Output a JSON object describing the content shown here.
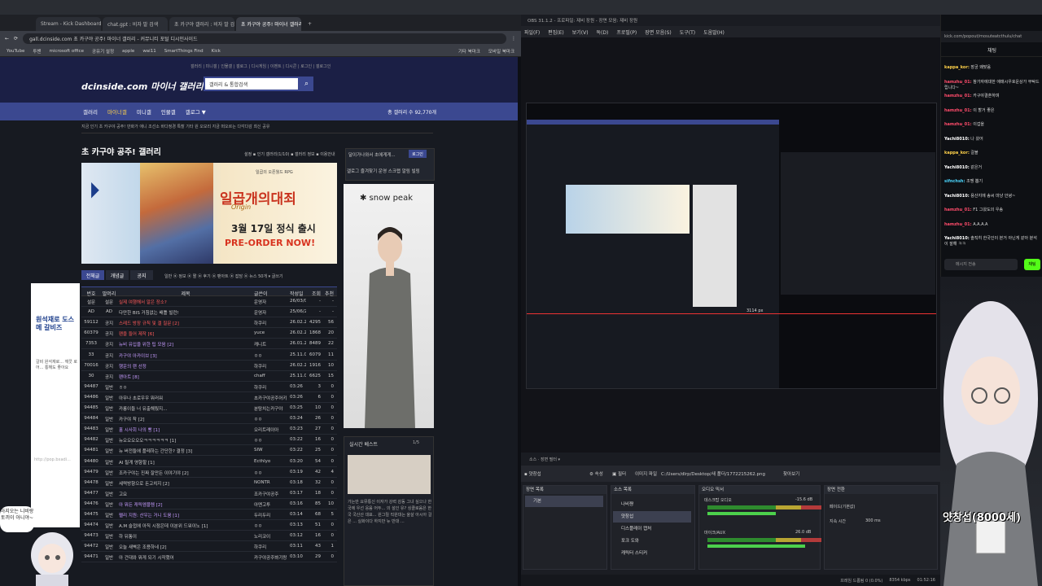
{
  "browser": {
    "tabs": [
      "Stream - Kick Dashboard",
      "chat.gpt : 비자 발 검색",
      "초 카구야 갤러리 : 비자 발 검색",
      "초 카구야 공주! 마이너 갤러리"
    ],
    "url": "gall.dcinside.com  초 카구야 공주! 마이너 갤러리 - 커뮤니티 포털 디시인사이드",
    "bookmarks": [
      "YouTube",
      "투챈",
      "microsoft office",
      "공유기 설정",
      "apple",
      "wai11",
      "SmartThings Find",
      "Kick",
      "기타 북마크",
      "모바일 북마크"
    ]
  },
  "dc": {
    "logo": "dcinside.com 마이너 갤러리",
    "search_placeholder": "갤러리 & 통합검색",
    "top_menu": "갤러리 | 미니갤 | 인물갤 | 갤로그 | 디시게임 | 이벤트 | 디시콘 | 로그인 | 갤로그인",
    "nav": [
      "갤러리",
      "마이너갤",
      "미니갤",
      "인물갤",
      "갤로그 ▼"
    ],
    "nav_count": "총 갤러리 수 92,770개",
    "cat_bar": "지금 인기  초 카구야 공주!   만화가   애니   조선소   바다정경   특촬   기타   원   오모리   지금 떠오르는   다각다감   최신   공유",
    "gallery_title": "초 카구야 공주! 갤러리",
    "gallery_tools": "설정 ▪ 인기 갤러리(1/10) ▪ 갤러리 정보 ▪ 이용안내",
    "right_panel": "달이가나와서 초에게게...",
    "login_btn": "로그인",
    "right_menu": "갤로그   즐겨찾기   운영   스크랩   알림   빌링",
    "ad1": {
      "top": "일곱의 오픈월드 RPG",
      "title": "일곱개의대죄",
      "sub": "Origin",
      "release": "3월 17일 정식 출시",
      "preorder": "PRE-ORDER NOW!"
    },
    "ad2_brand": "✱ snow peak",
    "tabs": [
      "전체글",
      "개념글",
      "공지"
    ],
    "filters": "일반  ⦿ 정보  ⦿ 짤  ⦿ 후기  ⦿ 팬아트  ⦿ 잡담  ⦿ 뉴스  50개 ▾  글쓰기",
    "headers": [
      "번호",
      "말머리",
      "제목",
      "글쓴이",
      "작성일",
      "조회",
      "추천"
    ],
    "rows": [
      {
        "no": "설문",
        "head": "설문",
        "title": "실제 여행해서 알은 장소?",
        "writer": "운영자",
        "date": "26/03/01",
        "views": "-",
        "rec": "-",
        "cls": "red"
      },
      {
        "no": "AD",
        "head": "AD",
        "title": "다만한 BIS 거침없는 배틀 빌런!",
        "writer": "운영자",
        "date": "25/06/24",
        "views": "-",
        "rec": "-",
        "cls": ""
      },
      {
        "no": "59112",
        "head": "공지",
        "title": "스레드 방장 규칙 및 갤 질문 [2]",
        "writer": "하쿠리",
        "date": "26.02.22",
        "views": "4295",
        "rec": "56",
        "cls": "red"
      },
      {
        "no": "60379",
        "head": "공지",
        "title": "팬을 들어 제작 [6]",
        "writer": "yuce",
        "date": "26.02.23",
        "views": "1868",
        "rec": "20",
        "cls": "red"
      },
      {
        "no": "7353",
        "head": "공지",
        "title": "뉴비 유입을 위한 팁 모음 [2]",
        "writer": "캐니트",
        "date": "26.01.27",
        "views": "8489",
        "rec": "22",
        "cls": "purple"
      },
      {
        "no": "33",
        "head": "공지",
        "title": "카구야 아카이브 [3]",
        "writer": "ㅇㅇ",
        "date": "25.11.08",
        "views": "6079",
        "rec": "11",
        "cls": "purple"
      },
      {
        "no": "70016",
        "head": "공지",
        "title": "행운의 랜 선정",
        "writer": "하쿠리",
        "date": "26.02.26",
        "views": "1916",
        "rec": "10",
        "cls": "purple"
      },
      {
        "no": "30",
        "head": "공지",
        "title": "팬아트 [8]",
        "writer": "chaff",
        "date": "25.11.08",
        "views": "6625",
        "rec": "15",
        "cls": "purple"
      },
      {
        "no": "94487",
        "head": "일반",
        "title": "ㅎㅇ",
        "writer": "하쿠리",
        "date": "03:26",
        "views": "3",
        "rec": "0",
        "cls": ""
      },
      {
        "no": "94486",
        "head": "일반",
        "title": "아무나 초로우우 뭐러워",
        "writer": "초카구야공주어키가...",
        "date": "03:26",
        "views": "6",
        "rec": "0",
        "cls": ""
      },
      {
        "no": "94485",
        "head": "일반",
        "title": "카롱이들 너 유출해뒀지...",
        "writer": "분탕치는카구야",
        "date": "03:25",
        "views": "10",
        "rec": "0",
        "cls": ""
      },
      {
        "no": "94484",
        "head": "일반",
        "title": "카구야 착 [2]",
        "writer": "ㅇㅇ",
        "date": "03:24",
        "views": "26",
        "rec": "0",
        "cls": ""
      },
      {
        "no": "94483",
        "head": "일반",
        "title": "홀 시사회 나의 빵 [1]",
        "writer": "오리트레이아",
        "date": "03:23",
        "views": "27",
        "rec": "0",
        "cls": "purple"
      },
      {
        "no": "94482",
        "head": "일반",
        "title": "뉴오오오오오ㅋㅋㅋㅋㅋㅋ [1]",
        "writer": "ㅇㅇ",
        "date": "03:22",
        "views": "16",
        "rec": "0",
        "cls": ""
      },
      {
        "no": "94481",
        "head": "일반",
        "title": "뉴 버전들에 플레하는 간단한? 결정 [3]",
        "writer": "SIW",
        "date": "03:22",
        "views": "25",
        "rec": "0",
        "cls": ""
      },
      {
        "no": "94480",
        "head": "일반",
        "title": "AI 될게 영향할 [1]",
        "writer": "Ecthlyo",
        "date": "03:20",
        "views": "54",
        "rec": "0",
        "cls": ""
      },
      {
        "no": "94479",
        "head": "일반",
        "title": "조카구야는 진짜 잘만든 이야기야 [2]",
        "writer": "ㅇㅇ",
        "date": "03:19",
        "views": "42",
        "rec": "4",
        "cls": ""
      },
      {
        "no": "94478",
        "head": "일반",
        "title": "세력방향으로 돈고치지 [2]",
        "writer": "NONTR",
        "date": "03:18",
        "views": "32",
        "rec": "0",
        "cls": ""
      },
      {
        "no": "94477",
        "head": "일반",
        "title": "고요",
        "writer": "조카구야공주",
        "date": "03:17",
        "views": "18",
        "rec": "0",
        "cls": ""
      },
      {
        "no": "94476",
        "head": "일반",
        "title": "아 뭐든 캐릭엠블렘 [2]",
        "writer": "아멘고투",
        "date": "03:16",
        "views": "85",
        "rec": "10",
        "cls": "purple"
      },
      {
        "no": "94475",
        "head": "일반",
        "title": "펠리 지원: 산우는 거니 도움 [1]",
        "writer": "두리두리",
        "date": "03:14",
        "views": "68",
        "rec": "5",
        "cls": "purple"
      },
      {
        "no": "94474",
        "head": "일반",
        "title": "A.M 슬접에 아직 시점은데 이분위 드워이노 [1]",
        "writer": "ㅇㅇ",
        "date": "03:13",
        "views": "51",
        "rec": "0",
        "cls": ""
      },
      {
        "no": "94473",
        "head": "일반",
        "title": "하 뒤통이",
        "writer": "노리코이",
        "date": "03:12",
        "views": "16",
        "rec": "0",
        "cls": ""
      },
      {
        "no": "94472",
        "head": "일반",
        "title": "오늘 새벽은 조용하네 [2]",
        "writer": "하쿠리",
        "date": "03:11",
        "views": "43",
        "rec": "1",
        "cls": ""
      },
      {
        "no": "94471",
        "head": "일반",
        "title": "아 건대와 뭐게 되기 시작했어",
        "writer": "카구야공주봐기랑",
        "date": "03:10",
        "views": "29",
        "rec": "0",
        "cls": ""
      }
    ],
    "live_title": "실시간 베스트",
    "live_pager": "1/5",
    "live_text": "가는만 요뮤통신 이자가 강력 감동 그녀 싶으나 한국에 우선 응음 어두... 의 설인 유? 싱클로움은 한국 국산산 대표... 원그릴 직원대는 울살 아시아 걸은 ... 실화이다 하지만 뉴 반대 ...",
    "popup_title": "원석재로 도스 메 갈비즈",
    "popup_sub": "갈비 원석재로... 깨끗 로 어... 통해도 좋아요",
    "popup_url": "http://pop.bxadi..."
  },
  "corner_bubble": "아지오는 니비랑 토끼이 아니야~",
  "obs": {
    "title_bar": "OBS 31.1.2 - 프로파일: 제비 장원 - 장면 모음: 제비 장원",
    "menu": [
      "파일(F)",
      "편집(E)",
      "보기(V)",
      "독(D)",
      "프로필(P)",
      "장면 모음(S)",
      "도구(T)",
      "도움말(H)"
    ],
    "px_label": "3114 px",
    "lower_bar": "소스  ·  장면 필터 ▾",
    "prop_source": "▪ 얏창섭",
    "prop_props": "⚙ 속성",
    "prop_filters": "▣ 필터",
    "prop_file_label": "이미지 파일",
    "prop_file": "C:/Users/dlrp/Desktop/새 폴더/1772215262.png",
    "prop_browse": "찾아보기",
    "scenes_header": "장면 목록",
    "scene_item": "기본",
    "sources_header": "소스 목록",
    "sources": [
      "나비쨩",
      "얏창섭",
      "디스플레이 캡처",
      "포크 도와",
      "캐릭터 스티커"
    ],
    "mixer_header": "오디오 믹서",
    "mixer": [
      {
        "name": "데스크탑 오디오",
        "db": "-15.6 dB"
      },
      {
        "name": "마이크/AUX",
        "db": "26.0 dB"
      }
    ],
    "transitions_header": "장면 전환",
    "transition_name": "페이드(기본값)",
    "transition_time_label": "지속 시간",
    "transition_time": "300 ms",
    "status": [
      "프레임 드롭됨 0 (0.0%)",
      "8354 kbps",
      "01:52:16"
    ]
  },
  "chat": {
    "url": "kick.com/popout/mosuteatcthulu/chat",
    "header": "채팅",
    "messages": [
      {
        "user": "kappa_kor:",
        "text": "장궁 왜맞음",
        "color": "#ffd24a"
      },
      {
        "user": "hamzhu_01:",
        "text": "참가자에대한 애매시우호운상가 부탁드립니다~",
        "color": "#ff4c6b"
      },
      {
        "user": "hamzhu_01:",
        "text": "카구야결혼하며",
        "color": "#ff4c6b"
      },
      {
        "user": "hamzhu_01:",
        "text": "이 할거 좋은",
        "color": "#ff4c6b"
      },
      {
        "user": "hamzhu_01:",
        "text": "이겁을",
        "color": "#ff4c6b"
      },
      {
        "user": "Yachi8010:",
        "text": "나 왔어",
        "color": "#ffffff"
      },
      {
        "user": "kappa_kor:",
        "text": "갈블",
        "color": "#ffd24a"
      },
      {
        "user": "Yachi8010:",
        "text": "같은거",
        "color": "#ffffff"
      },
      {
        "user": "sifnchsh:",
        "text": "조맹 뽑기",
        "color": "#4cd8ff"
      },
      {
        "user": "Yachi8010:",
        "text": "용산지에 송씨 마냥 안녕~",
        "color": "#ffffff"
      },
      {
        "user": "hamzhu_01:",
        "text": "F1 그왔도의 우송",
        "color": "#ff4c6b"
      },
      {
        "user": "hamzhu_01:",
        "text": "A.A.A.A",
        "color": "#ff4c6b"
      },
      {
        "user": "Yachi8010:",
        "text": "솔직히 한국인이 본거 아닌게 같아 분석이 잘해 ㅋㅋ",
        "color": "#ffffff"
      }
    ],
    "input_placeholder": "메시지 전송",
    "send": "채팅"
  },
  "vtuber_name": "얏창섭(8000세)",
  "colors": {
    "dc_blue": "#3b4890",
    "kick_green": "#53fc18"
  }
}
